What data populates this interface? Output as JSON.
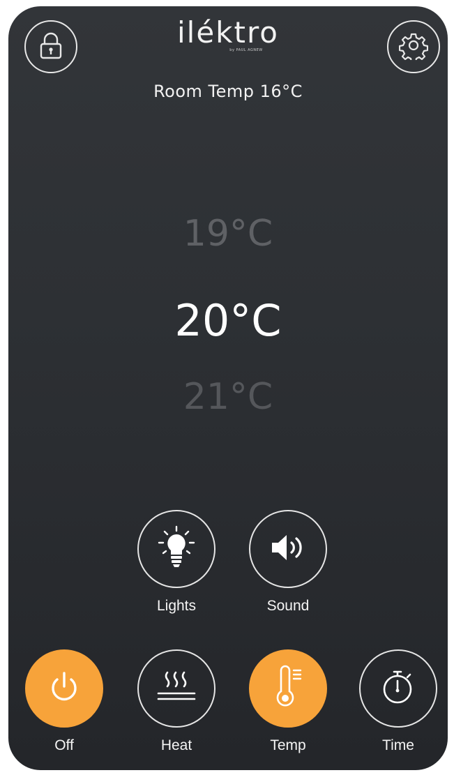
{
  "header": {
    "brand_name": "iléktro",
    "brand_sub": "by PAUL AGNEW",
    "lock_icon": "lock-icon",
    "settings_icon": "gear-icon"
  },
  "room_temp": "Room Temp 16°C",
  "temperature_picker": {
    "previous": "19°C",
    "selected": "20°C",
    "next": "21°C"
  },
  "features": [
    {
      "label": "Lights",
      "icon": "bulb-icon"
    },
    {
      "label": "Sound",
      "icon": "speaker-icon"
    }
  ],
  "bottom_controls": [
    {
      "label": "Off",
      "icon": "power-icon",
      "active": true
    },
    {
      "label": "Heat",
      "icon": "heat-waves-icon",
      "active": false
    },
    {
      "label": "Temp",
      "icon": "thermometer-icon",
      "active": true
    },
    {
      "label": "Time",
      "icon": "stopwatch-icon",
      "active": false
    }
  ],
  "colors": {
    "accent": "#f7a33a",
    "background": "#2d3034"
  }
}
